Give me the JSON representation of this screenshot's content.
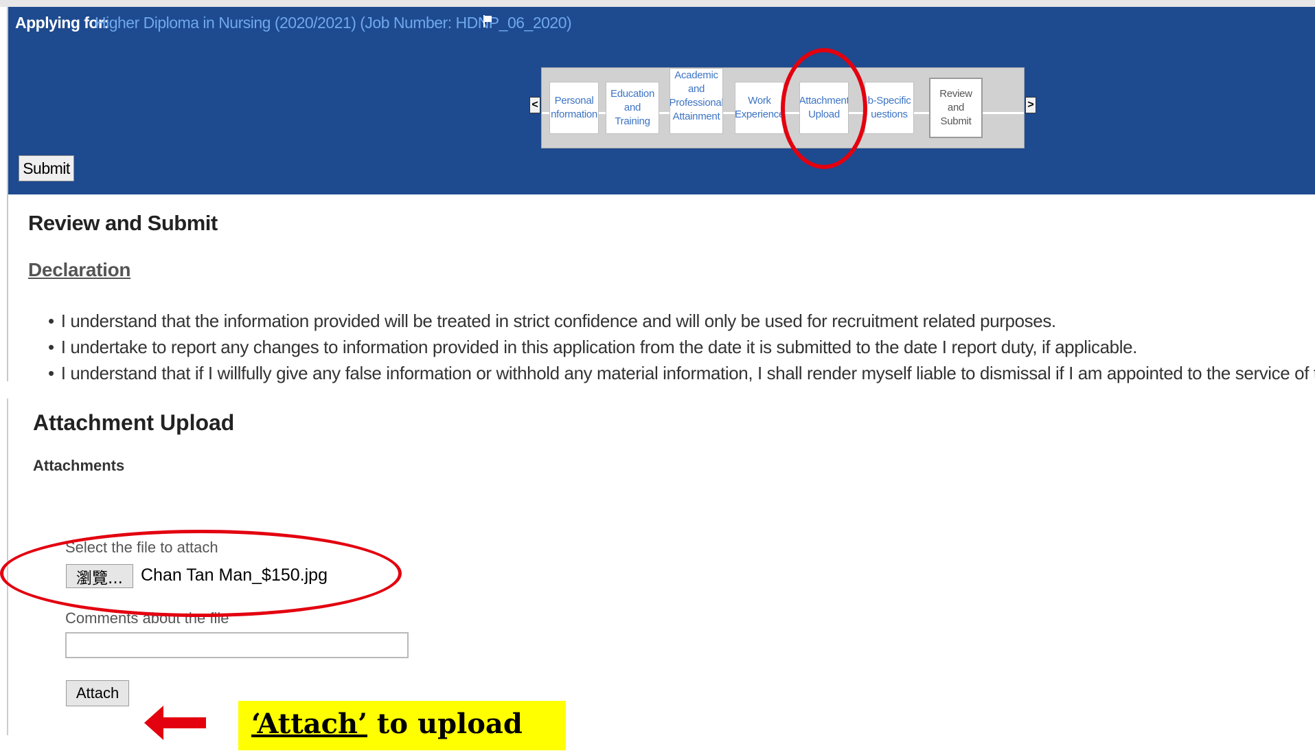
{
  "header": {
    "applying_label": "Applying for:",
    "job_link": "Higher Diploma in Nursing (2020/2021) (Job Number: HDNP_06_2020)"
  },
  "stepper": {
    "prev_arrow": "<",
    "next_arrow": ">",
    "steps": [
      {
        "lines": [
          "Personal",
          "nformation"
        ]
      },
      {
        "lines": [
          "Education",
          "and Training"
        ]
      },
      {
        "lines": [
          "Academic",
          "and",
          "Professional",
          "Attainment"
        ]
      },
      {
        "lines": [
          "Work",
          "Experience"
        ]
      },
      {
        "lines": [
          "Attachment",
          "Upload"
        ]
      },
      {
        "lines": [
          "b-Specific",
          "uestions"
        ]
      },
      {
        "lines": [
          "Review and",
          "Submit"
        ]
      }
    ]
  },
  "toolbar": {
    "submit_label": "Submit"
  },
  "review": {
    "title": "Review and Submit",
    "declaration_title": "Declaration",
    "declarations": [
      "I understand that the information provided will be treated in strict confidence and will only be used for recruitment related purposes.",
      "I undertake to report any changes to information provided in this application from the date it is submitted to the date I report duty, if applicable.",
      "I understand that if I willfully give any false information or withhold any material information, I shall render myself liable to dismissal if I am appointed to the service of the HA."
    ]
  },
  "upload": {
    "title": "Attachment Upload",
    "attachments_label": "Attachments",
    "select_label": "Select the file to attach",
    "browse_label": "瀏覽...",
    "file_name": "Chan Tan Man_$150.jpg",
    "comments_label": "Comments about the file",
    "comments_value": "",
    "attach_label": "Attach"
  },
  "annotation": {
    "callout_quoted": "‘Attach’",
    "callout_rest": " to upload",
    "highlight_color": "#ffff00",
    "circle_color": "#e3000f",
    "arrow_color": "#e3000f"
  },
  "colors": {
    "header_bg": "#1e4a8f",
    "link": "#6fa8ec"
  }
}
